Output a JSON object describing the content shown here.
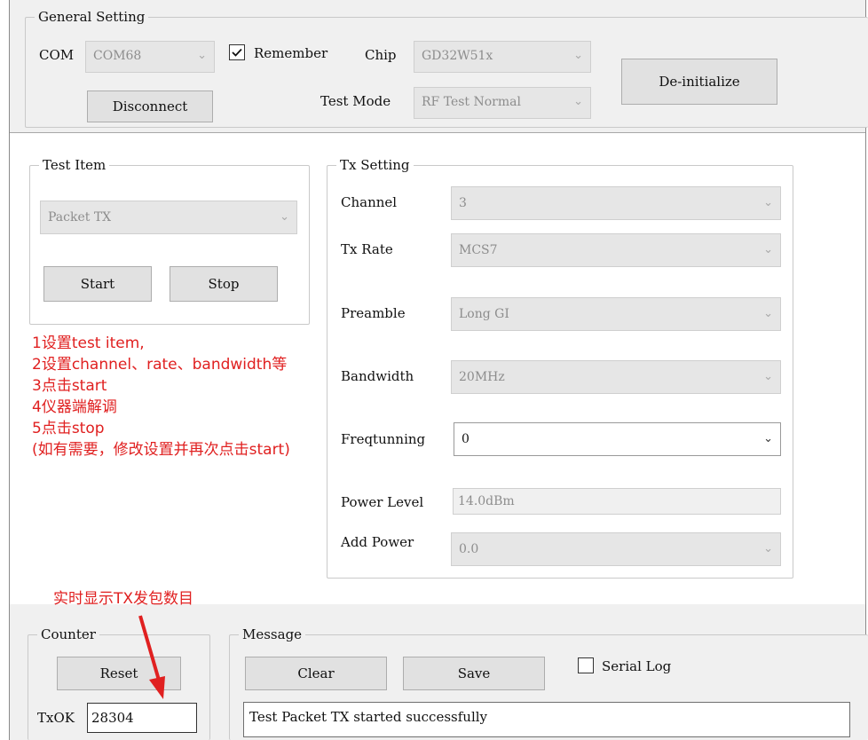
{
  "general": {
    "title": "General Setting",
    "com_label": "COM",
    "com_value": "COM68",
    "remember_label": "Remember",
    "remember_checked": true,
    "chip_label": "Chip",
    "chip_value": "GD32W51x",
    "disconnect_label": "Disconnect",
    "test_mode_label": "Test Mode",
    "test_mode_value": "RF Test Normal",
    "deinit_label": "De-initialize"
  },
  "test_item": {
    "title": "Test Item",
    "value": "Packet TX",
    "start_label": "Start",
    "stop_label": "Stop"
  },
  "tx_setting": {
    "title": "Tx Setting",
    "channel_label": "Channel",
    "channel_value": "3",
    "tx_rate_label": "Tx Rate",
    "tx_rate_value": "MCS7",
    "preamble_label": "Preamble",
    "preamble_value": "Long GI",
    "bandwidth_label": "Bandwidth",
    "bandwidth_value": "20MHz",
    "freqtunning_label": "Freqtunning",
    "freqtunning_value": "0",
    "power_level_label": "Power Level",
    "power_level_value": "14.0dBm",
    "add_power_label": "Add Power",
    "add_power_value": "0.0"
  },
  "annotations": {
    "steps": [
      "1设置test item,",
      "2设置channel、rate、bandwidth等",
      "3点击start",
      "4仪器端解调",
      "5点击stop",
      "(如有需要，修改设置并再次点击start)"
    ],
    "counter_note": "实时显示TX发包数目",
    "color": "#e02020"
  },
  "counter": {
    "title": "Counter",
    "reset_label": "Reset",
    "txok_label": "TxOK",
    "txok_value": "28304"
  },
  "message": {
    "title": "Message",
    "clear_label": "Clear",
    "save_label": "Save",
    "serial_log_label": "Serial Log",
    "serial_log_checked": false,
    "text": "Test Packet TX started successfully"
  },
  "icons": {
    "dropdown": "chevron-down-icon",
    "check": "checkmark-icon",
    "arrow": "red-arrow-annotation"
  }
}
